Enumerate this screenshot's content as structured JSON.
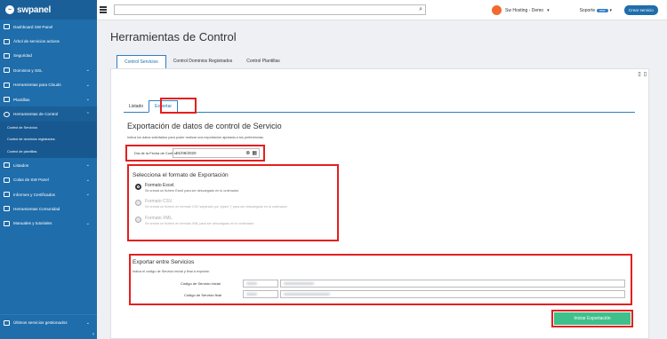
{
  "brand": {
    "name": "swpanel"
  },
  "sidebar": {
    "items": [
      {
        "label": "Dashboard SW Panel",
        "icon": "dashboard-icon"
      },
      {
        "label": "Árbol de servicios activos",
        "icon": "tree-icon"
      },
      {
        "label": "Seguridad",
        "icon": "shield-icon"
      },
      {
        "label": "Dominios y SSL",
        "icon": "globe-icon"
      },
      {
        "label": "Herramientas para Clouds",
        "icon": "cloud-tools-icon"
      },
      {
        "label": "Plantillas",
        "icon": "template-icon"
      },
      {
        "label": "Herramientas de Control",
        "icon": "check-circle-icon"
      }
    ],
    "subitems": [
      "Control de Servicios",
      "Control de dominios registrados",
      "Control de plantillas"
    ],
    "items2": [
      {
        "label": "Listados",
        "icon": "list-icon"
      },
      {
        "label": "Colas de SW Panel",
        "icon": "queue-icon"
      },
      {
        "label": "Informes y Certificados",
        "icon": "report-icon"
      },
      {
        "label": "Herramientas Comunidad",
        "icon": "community-icon"
      },
      {
        "label": "Manuales y tutoriales",
        "icon": "book-icon"
      }
    ],
    "bottom_item": "Últimos servicios gestionados"
  },
  "topbar": {
    "search_placeholder": "",
    "account": "Sw Hosting - Demo",
    "soporte": "Soporte",
    "soporte_badge": "new",
    "crear": "Crear servicio"
  },
  "page": {
    "title": "Herramientas de Control"
  },
  "tabs": [
    "Control Servicios",
    "Control Dominios Registrados",
    "Control Plantillas"
  ],
  "subtabs": [
    "Listado",
    "Exportar"
  ],
  "export": {
    "title": "Exportación de datos de control de Servicio",
    "desc": "Indica los datos solicitados para poder realizar una exportación ajustada a tus preferencias.",
    "fecha_label": "Día de la Fecha de Control",
    "fecha_value": "01/06/2020",
    "format_title": "Selecciona el formato de Exportación",
    "formats": [
      {
        "title": "Formato Excel.",
        "desc": "Se creará un fichero Excel para ser descargado en tu ordenador.",
        "selected": true
      },
      {
        "title": "Formato CSV.",
        "desc": "Se creará un fichero en formato CSV separado por 'pipes' '|' para ser descargado en tu ordenador.",
        "selected": false
      },
      {
        "title": "Formato XML.",
        "desc": "Se creará un fichero en formato XML para ser descargado en tu ordenador.",
        "selected": false
      }
    ],
    "between_title": "Exportar entre Servicios",
    "between_desc": "Indica el código de Servicio inicial y final a exportar.",
    "inicial_label": "Código de Servicio inicial",
    "final_label": "Código de Servicio final",
    "start_button": "Iniciar Exportación"
  },
  "colors": {
    "sidebar": "#1f6dab",
    "accent": "#2f7fc4",
    "highlight": "#e41f1f",
    "start": "#3fbf8a"
  }
}
